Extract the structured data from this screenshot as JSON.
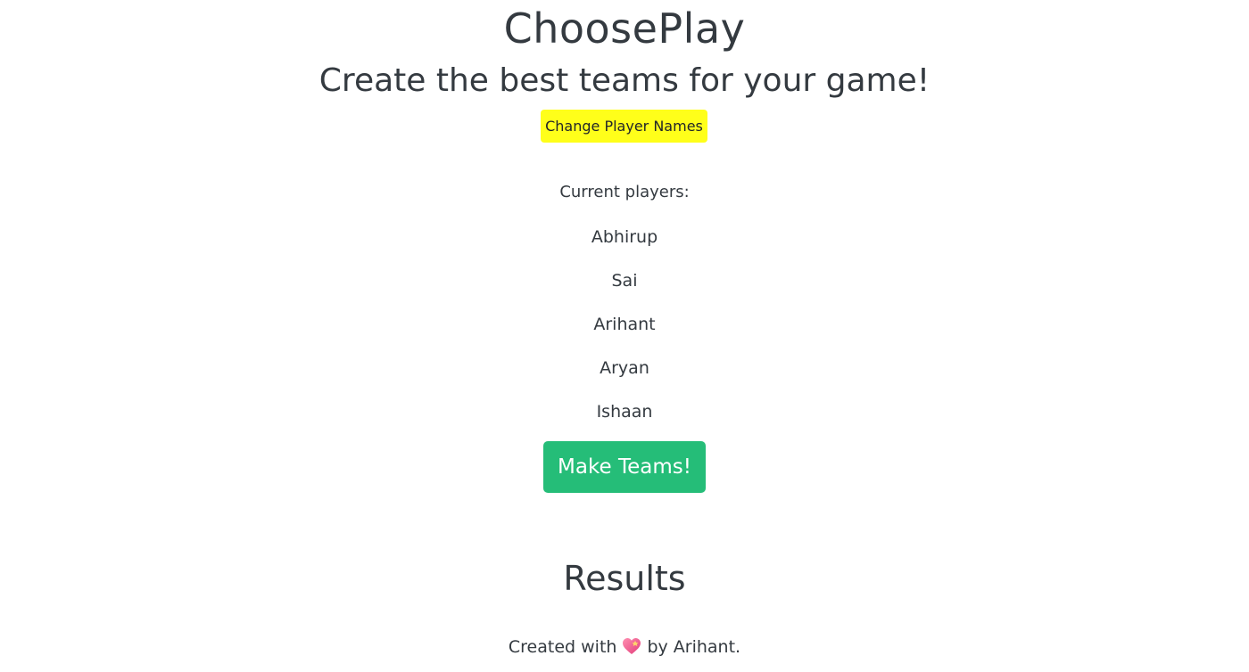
{
  "header": {
    "title": "ChoosePlay",
    "subtitle": "Create the best teams for your game!"
  },
  "actions": {
    "change_names_label": "Change Player Names",
    "make_teams_label": "Make Teams!"
  },
  "players": {
    "label": "Current players:",
    "names": [
      "Abhirup",
      "Sai",
      "Arihant",
      "Aryan",
      "Ishaan"
    ]
  },
  "results": {
    "heading": "Results"
  },
  "footer": {
    "prefix": "Created with",
    "icon": "heart-icon",
    "suffix": "by Arihant."
  },
  "colors": {
    "change_button_bg": "#ffff1a",
    "make_button_bg": "#25bd78",
    "text": "#343a40",
    "heart": "#f05a8c"
  }
}
